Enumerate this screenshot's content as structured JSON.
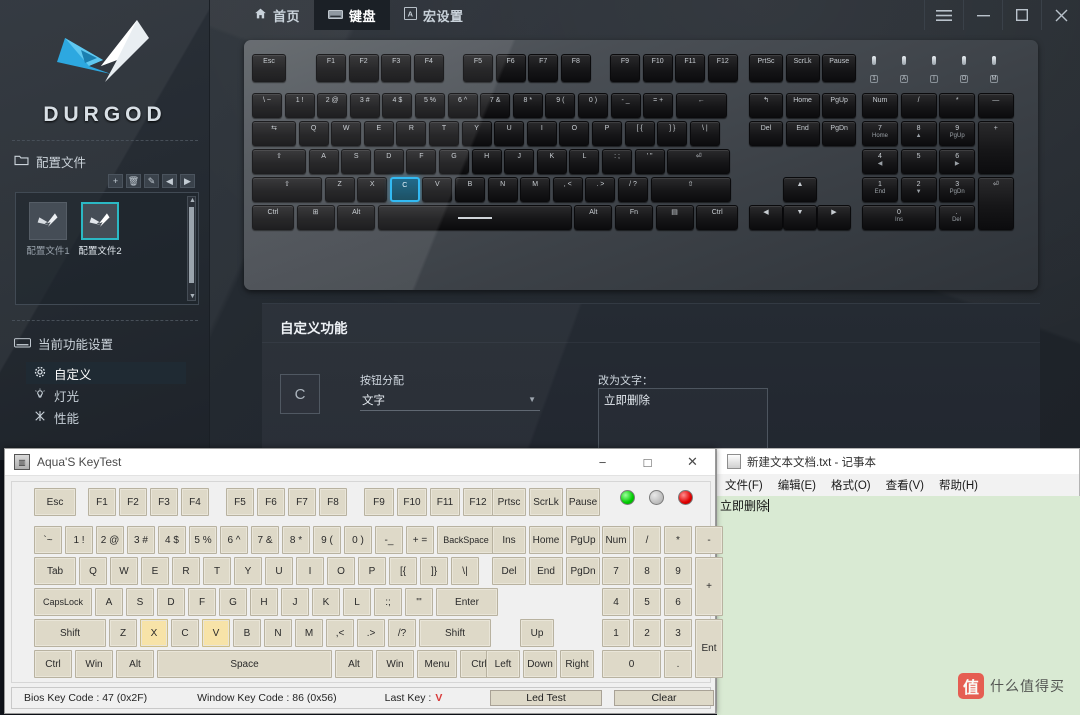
{
  "durgod": {
    "nav": [
      {
        "label": "首页",
        "icon": "home-icon",
        "active": false
      },
      {
        "label": "键盘",
        "icon": "keyboard-icon",
        "active": true
      },
      {
        "label": "宏设置",
        "icon": "macro-icon",
        "active": false
      }
    ],
    "window_buttons": [
      "menu-icon",
      "minimize-icon",
      "maximize-icon",
      "close-icon"
    ],
    "brand": "DURGOD",
    "sidebar": {
      "profile_section_title": "配置文件",
      "profile_tools": [
        "+",
        "🗑",
        "✎",
        "◀",
        "▶"
      ],
      "profiles": [
        {
          "label": "配置文件1",
          "selected": false
        },
        {
          "label": "配置文件2",
          "selected": true
        }
      ],
      "function_section_title": "当前功能设置",
      "functions": [
        {
          "label": "自定义",
          "icon": "gear-icon",
          "active": true
        },
        {
          "label": "灯光",
          "icon": "light-icon",
          "active": false
        },
        {
          "label": "性能",
          "icon": "performance-icon",
          "active": false
        }
      ]
    },
    "custom_panel": {
      "title": "自定义功能",
      "selected_key": "C",
      "assign_label": "按钮分配",
      "assign_value": "文字",
      "text_label": "改为文字：",
      "text_value": "立即删除"
    },
    "keyboard": {
      "lit_key": "C",
      "leds": [
        "1",
        "A",
        "I",
        "O",
        "M"
      ],
      "rows": {
        "fn": [
          "Esc",
          "F1",
          "F2",
          "F3",
          "F4",
          "F5",
          "F6",
          "F7",
          "F8",
          "F9",
          "F10",
          "F11",
          "F12",
          "PrtSc",
          "ScrLk",
          "Pause"
        ],
        "num": [
          "\\ ~",
          "1 !",
          "2 @",
          "3 #",
          "4 $",
          "5 %",
          "6 ^",
          "7 &",
          "8 *",
          "9 (",
          "0 )",
          "- _",
          "= +",
          "←"
        ],
        "qwerty": [
          "⇆",
          "Q",
          "W",
          "E",
          "R",
          "T",
          "Y",
          "U",
          "I",
          "O",
          "P",
          "[ {",
          "] }",
          "\\ |"
        ],
        "home": [
          "⇧",
          "A",
          "S",
          "D",
          "F",
          "G",
          "H",
          "J",
          "K",
          "L",
          ": ;",
          "' \"",
          "⏎"
        ],
        "shift": [
          "⇧",
          "Z",
          "X",
          "C",
          "V",
          "B",
          "N",
          "M",
          ", <",
          ". >",
          "/ ?",
          "⇧"
        ],
        "bottom": [
          "Ctrl",
          "⊞",
          "Alt",
          "",
          "Alt",
          "Fn",
          "▤",
          "Ctrl"
        ],
        "navcluster": [
          "↰",
          "Home",
          "PgUp",
          "Del",
          "End",
          "PgDn"
        ],
        "arrows": [
          "▲",
          "◀",
          "▼",
          "▶"
        ],
        "numpad": [
          "Num",
          "/",
          "*",
          "—",
          "7",
          "8",
          "9",
          "+",
          "4",
          "5",
          "6",
          "1",
          "2",
          "3",
          "0",
          "."
        ],
        "numpad_sub": [
          "Home",
          "▲",
          "PgUp",
          "◀",
          "",
          "▶",
          "End",
          "▼",
          "PgDn",
          "Ins",
          "Del"
        ]
      }
    }
  },
  "keytest": {
    "title": "Aqua'S KeyTest",
    "window_buttons": [
      "−",
      "□",
      "✕"
    ],
    "rows": {
      "f_row": [
        "Esc",
        "F1",
        "F2",
        "F3",
        "F4",
        "F5",
        "F6",
        "F7",
        "F8",
        "F9",
        "F10",
        "F11",
        "F12",
        "Prtsc",
        "ScrLk",
        "Pause"
      ],
      "num_row": [
        "`~",
        "1 !",
        "2 @",
        "3 #",
        "4 $",
        "5 %",
        "6 ^",
        "7 &",
        "8 *",
        "9 (",
        "0 )",
        "-_",
        "+ =",
        "BackSpace"
      ],
      "num_nav": [
        "Ins",
        "Home",
        "PgUp"
      ],
      "num_pad_top": [
        "Num",
        "/",
        "*",
        "-"
      ],
      "tab_row": [
        "Tab",
        "Q",
        "W",
        "E",
        "R",
        "T",
        "Y",
        "U",
        "I",
        "O",
        "P",
        "[{",
        "]}",
        "\\|"
      ],
      "tab_nav": [
        "Del",
        "End",
        "PgDn"
      ],
      "tab_pad": [
        "7",
        "8",
        "9"
      ],
      "caps_row": [
        "CapsLock",
        "A",
        "S",
        "D",
        "F",
        "G",
        "H",
        "J",
        "K",
        "L",
        ":;",
        "'\"",
        "Enter"
      ],
      "caps_pad": [
        "4",
        "5",
        "6"
      ],
      "plus_key": "+",
      "shift_row": [
        "Shift",
        "Z",
        "X",
        "C",
        "V",
        "B",
        "N",
        "M",
        ",<",
        ".>",
        "/?",
        "Shift"
      ],
      "shift_nav": [
        "Up"
      ],
      "shift_pad": [
        "1",
        "2",
        "3"
      ],
      "ctrl_row": [
        "Ctrl",
        "Win",
        "Alt",
        "Space",
        "Alt",
        "Win",
        "Menu",
        "Ctrl"
      ],
      "ctrl_nav": [
        "Left",
        "Down",
        "Right"
      ],
      "ctrl_pad": [
        "0",
        "."
      ],
      "ent_key": "Ent"
    },
    "highlighted_keys": [
      "X",
      "V"
    ],
    "leds": [
      {
        "name": "led-green",
        "color": "#00cc00"
      },
      {
        "name": "led-grey",
        "color": "#c0c0c0"
      },
      {
        "name": "led-red",
        "color": "#e00000"
      }
    ],
    "status": {
      "bios_key_code": "Bios Key Code : 47 (0x2F)",
      "window_key_code": "Window Key Code : 86 (0x56)",
      "last_key_label": "Last Key :",
      "last_key_value": "V",
      "led_test_button": "Led Test",
      "clear_button": "Clear"
    }
  },
  "notepad": {
    "title": "新建文本文档.txt - 记事本",
    "menu": [
      "文件(F)",
      "编辑(E)",
      "格式(O)",
      "查看(V)",
      "帮助(H)"
    ],
    "content": "立即删除"
  },
  "watermark": {
    "badge": "值",
    "text": "什么值得买"
  },
  "colors": {
    "accent_cyan": "#21b4f2",
    "profile_selected": "#2bb8c4",
    "orange_rule": "#d2763a",
    "keytest_highlight": "#f7e3a8",
    "notepad_bg": "#d9ead3"
  }
}
